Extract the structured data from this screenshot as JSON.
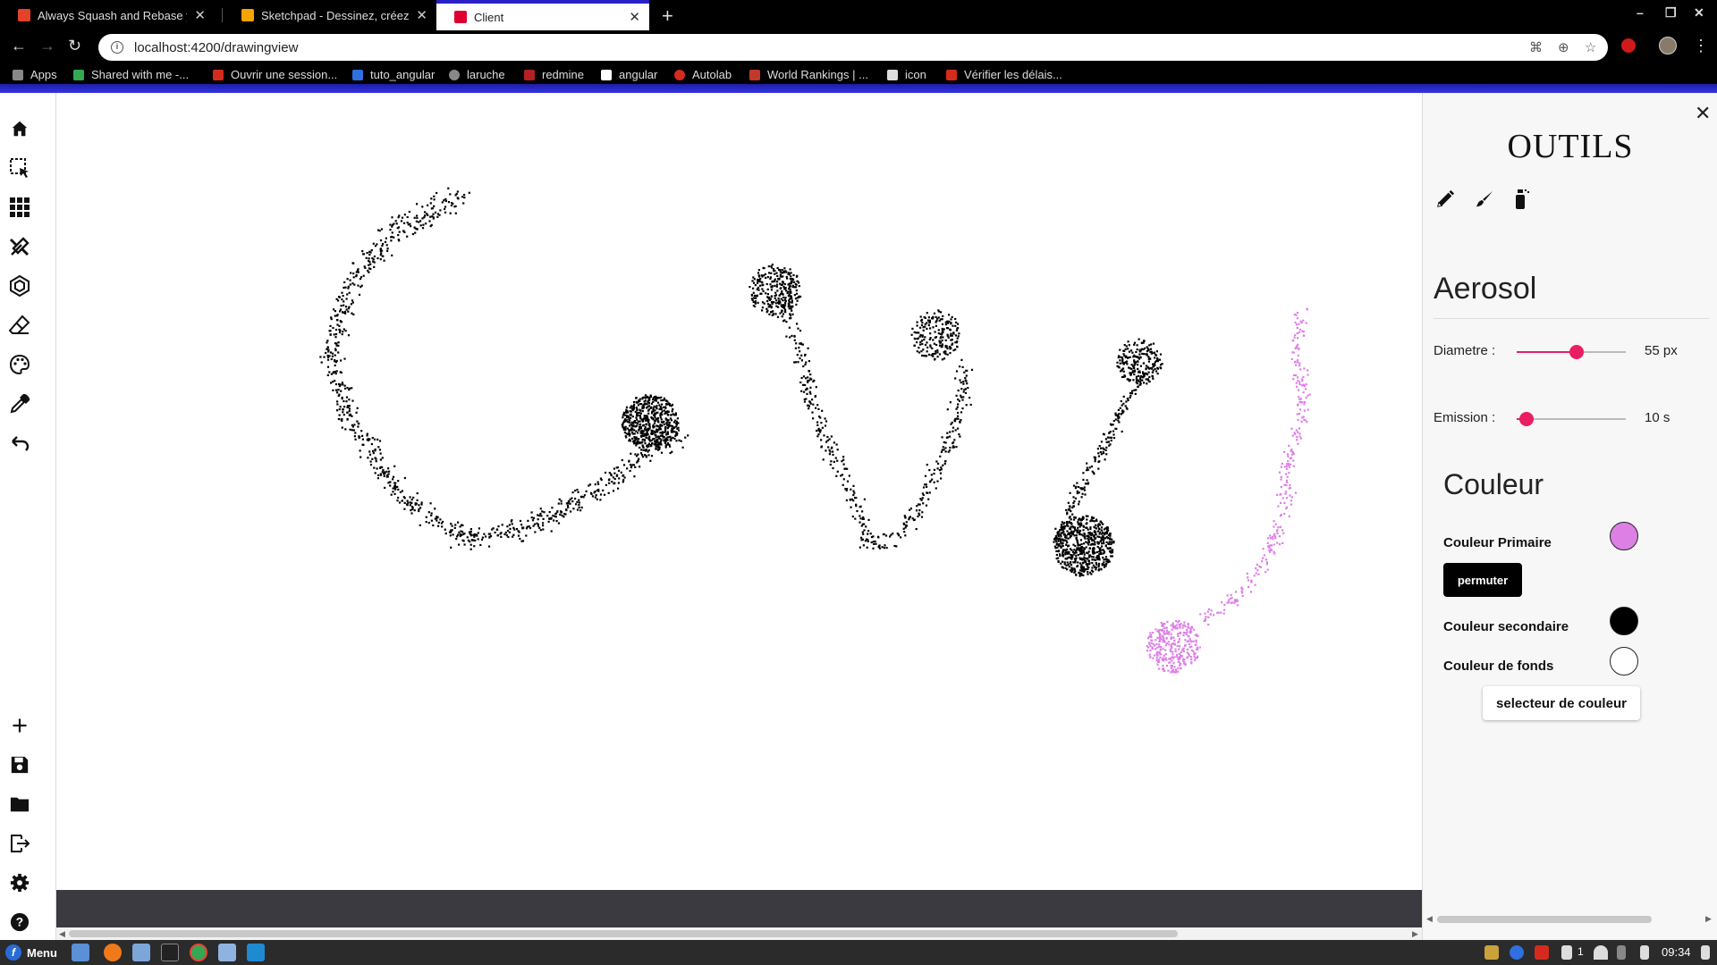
{
  "browser": {
    "tabs": [
      {
        "title": "Always Squash and Rebase your",
        "active": false,
        "favicon_color": "#e24329"
      },
      {
        "title": "Sketchpad - Dessinez, créez, par",
        "active": false,
        "favicon_color": "#f4a300"
      },
      {
        "title": "Client",
        "active": true,
        "favicon_color": "#dd0031"
      }
    ],
    "url": "localhost:4200/drawingview",
    "bookmarks": [
      {
        "label": "Apps",
        "color": "#888888"
      },
      {
        "label": "Shared with me -...",
        "color": "#34a853"
      },
      {
        "label": "Ouvrir une session...",
        "color": "#d52b1e"
      },
      {
        "label": "tuto_angular",
        "color": "#2f6fdf"
      },
      {
        "label": "laruche",
        "color": "#888888"
      },
      {
        "label": "redmine",
        "color": "#b32024"
      },
      {
        "label": "angular",
        "color": "#ffffff"
      },
      {
        "label": "Autolab",
        "color": "#d52b1e"
      },
      {
        "label": "World Rankings | ...",
        "color": "#c0392b"
      },
      {
        "label": "icon",
        "color": "#dddddd"
      },
      {
        "label": "Vérifier les délais...",
        "color": "#d52b1e"
      }
    ]
  },
  "sidebar": {
    "top_icons": [
      "home-icon",
      "select-icon",
      "grid-icon",
      "tools-icon",
      "polygon-icon",
      "eraser-icon",
      "palette-icon",
      "pipette-icon",
      "undo-icon"
    ],
    "bottom_icons": [
      "new-icon",
      "save-icon",
      "open-folder-icon",
      "export-icon",
      "settings-icon",
      "help-icon"
    ]
  },
  "panel": {
    "title": "OUTILS",
    "tool_icons": [
      "pencil-icon",
      "brush-icon",
      "spray-can-icon"
    ],
    "tool_name": "Aerosol",
    "diameter": {
      "label": "Diametre :",
      "value": 55,
      "display": "55 px",
      "min": 1,
      "max": 100
    },
    "emission": {
      "label": "Emission :",
      "value": 10,
      "display": "10 s",
      "min": 1,
      "max": 100
    },
    "color_title": "Couleur",
    "primary_label": "Couleur Primaire",
    "primary_color": "#dd80e6",
    "swap_button": "permuter",
    "secondary_label": "Couleur secondaire",
    "secondary_color": "#000000",
    "background_label": "Couleur de fonds",
    "background_color": "#ffffff",
    "picker_button": "selecteur de couleur"
  },
  "taskbar": {
    "menu_label": "Menu",
    "clock": "09:34",
    "tray_number": "1"
  }
}
